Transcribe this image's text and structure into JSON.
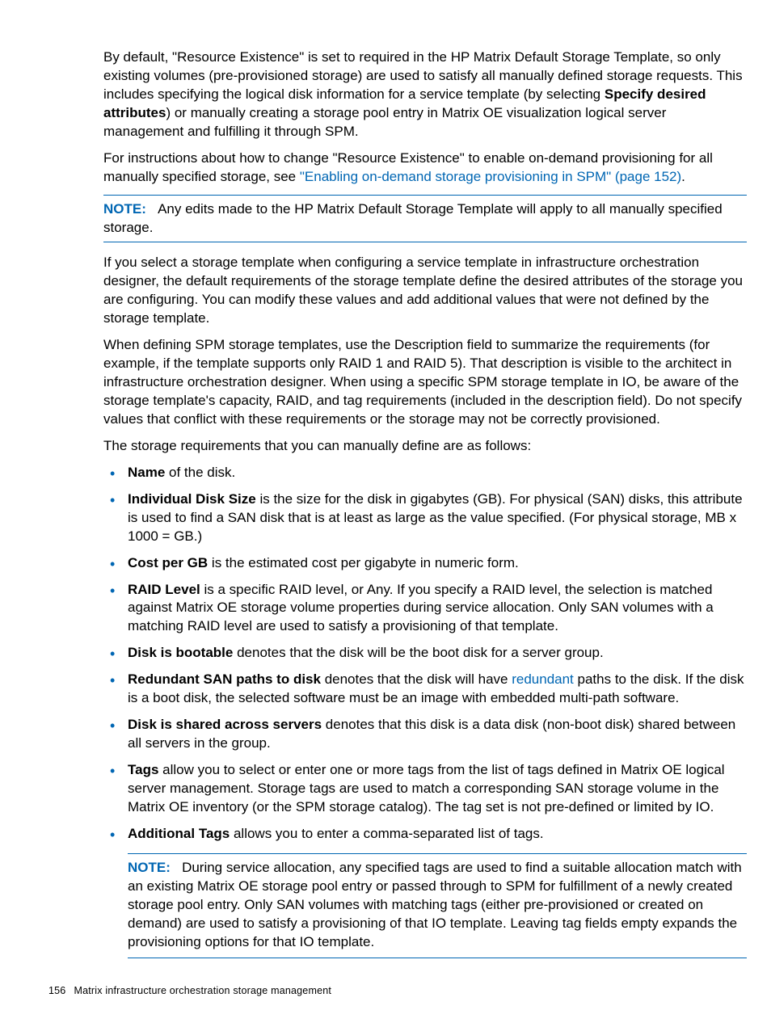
{
  "para1_a": "By default, \"Resource Existence\" is set to required in the HP Matrix Default Storage Template, so only existing volumes (pre-provisioned storage) are used to satisfy all manually defined storage requests. This includes specifying the logical disk information for a service template (by selecting ",
  "para1_b": "Specify desired attributes",
  "para1_c": ") or manually creating a storage pool entry in Matrix OE visualization logical server management and fulfilling it through SPM.",
  "para2_a": "For instructions about how to change \"Resource Existence\" to enable on-demand provisioning for all manually specified storage, see ",
  "para2_link": "\"Enabling on-demand storage provisioning in SPM\" (page 152)",
  "para2_b": ".",
  "note1_label": "NOTE:",
  "note1_text": "Any edits made to the HP Matrix Default Storage Template will apply to all manually specified storage.",
  "para3": "If you select a storage template when configuring a service template in infrastructure orchestration designer, the default requirements of the storage template define the desired attributes of the storage you are configuring. You can modify these values and add additional values that were not defined by the storage template.",
  "para4": "When defining SPM storage templates, use the Description field to summarize the requirements (for example, if the template supports only RAID 1 and RAID 5). That description is visible to the architect in infrastructure orchestration designer. When using a specific SPM storage template in IO, be aware of the storage template's capacity, RAID, and tag requirements (included in the description field). Do not specify values that conflict with these requirements or the storage may not be correctly provisioned.",
  "para5": "The storage requirements that you can manually define are as follows:",
  "li1_b": "Name",
  "li1_t": " of the disk.",
  "li2_b": "Individual Disk Size",
  "li2_t": " is the size for the disk in gigabytes (GB). For physical (SAN) disks, this attribute is used to find a SAN disk that is at least as large as the value specified. (For physical storage, MB x 1000 = GB.)",
  "li3_b": "Cost per GB",
  "li3_t": " is the estimated cost per gigabyte in numeric form.",
  "li4_b": "RAID Level",
  "li4_t": " is a specific RAID level, or Any. If you specify a RAID level, the selection is matched against Matrix OE storage volume properties during service allocation. Only SAN volumes with a matching RAID level are used to satisfy a provisioning of that template.",
  "li5_b": "Disk is bootable",
  "li5_t": " denotes that the disk will be the boot disk for a server group.",
  "li6_b": "Redundant SAN paths to disk",
  "li6_t1": " denotes that the disk will have ",
  "li6_link": "redundant",
  "li6_t2": " paths to the disk. If the disk is a boot disk, the selected software must be an image with embedded multi-path software.",
  "li7_b": "Disk is shared across servers",
  "li7_t": " denotes that this disk is a data disk (non-boot disk) shared between all servers in the group.",
  "li8_b": "Tags",
  "li8_t": " allow you to select or enter one or more tags from the list of tags defined in Matrix OE logical server management. Storage tags are used to match a corresponding SAN storage volume in the Matrix OE inventory (or the SPM storage catalog). The tag set is not pre-defined or limited by IO.",
  "li9_b": "Additional Tags",
  "li9_t": " allows you to enter a comma-separated list of tags.",
  "note2_label": "NOTE:",
  "note2_text": "During service allocation, any specified tags are used to find a suitable allocation match with an existing Matrix OE storage pool entry or passed through to SPM for fulfillment of a newly created storage pool entry. Only SAN volumes with matching tags (either pre-provisioned or created on demand) are used to satisfy a provisioning of that IO template. Leaving tag fields empty expands the provisioning options for that IO template.",
  "footer_page": "156",
  "footer_title": "Matrix infrastructure orchestration storage management"
}
